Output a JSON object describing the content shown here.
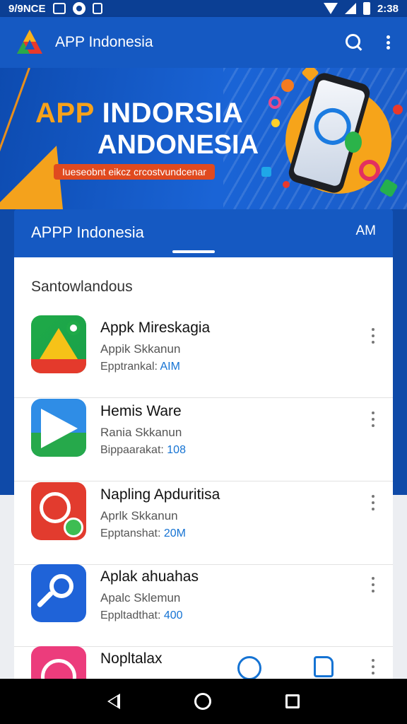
{
  "status_bar": {
    "left_text": "9/9NCE",
    "time": "2:38"
  },
  "app_bar": {
    "title": "APP Indonesia",
    "search_icon": "search-icon",
    "more_icon": "more-vert-icon"
  },
  "banner": {
    "title_accent": "APP",
    "title_rest": " INDORSIA",
    "title_line2": "ANDONESIA",
    "tagline": "Iueseobnt eikcz crcostvundcenar"
  },
  "tabs": {
    "active": "APPP Indonesia",
    "secondary": "AM"
  },
  "section": {
    "title": "Santowlandous"
  },
  "apps": [
    {
      "name": "Appk Mireskagia",
      "subtitle": "Appik Skkanun",
      "meta_label": "Epptrankal: ",
      "meta_value": "AIM",
      "icon": "drive-icon"
    },
    {
      "name": "Hemis Ware",
      "subtitle": "Rania Skkanun",
      "meta_label": "Bippaarakat: ",
      "meta_value": "108",
      "icon": "play-icon"
    },
    {
      "name": "Napling Apduritisa",
      "subtitle": "Aprlk Skkanun",
      "meta_label": "Epptanshat: ",
      "meta_value": "20M",
      "icon": "wrench-icon"
    },
    {
      "name": "Aplak ahuahas",
      "subtitle": "Apalc Sklemun",
      "meta_label": "Eppltadthat: ",
      "meta_value": "400",
      "icon": "search-app-icon"
    },
    {
      "name": "Nopltalax",
      "subtitle": "",
      "meta_label": "",
      "meta_value": "",
      "icon": "chat-app-icon"
    }
  ],
  "nav": {
    "back": "back-icon",
    "home": "home-icon",
    "recents": "recents-icon"
  },
  "colors": {
    "primary": "#1559c2",
    "accent": "#f7a21b",
    "link": "#1573d3"
  }
}
